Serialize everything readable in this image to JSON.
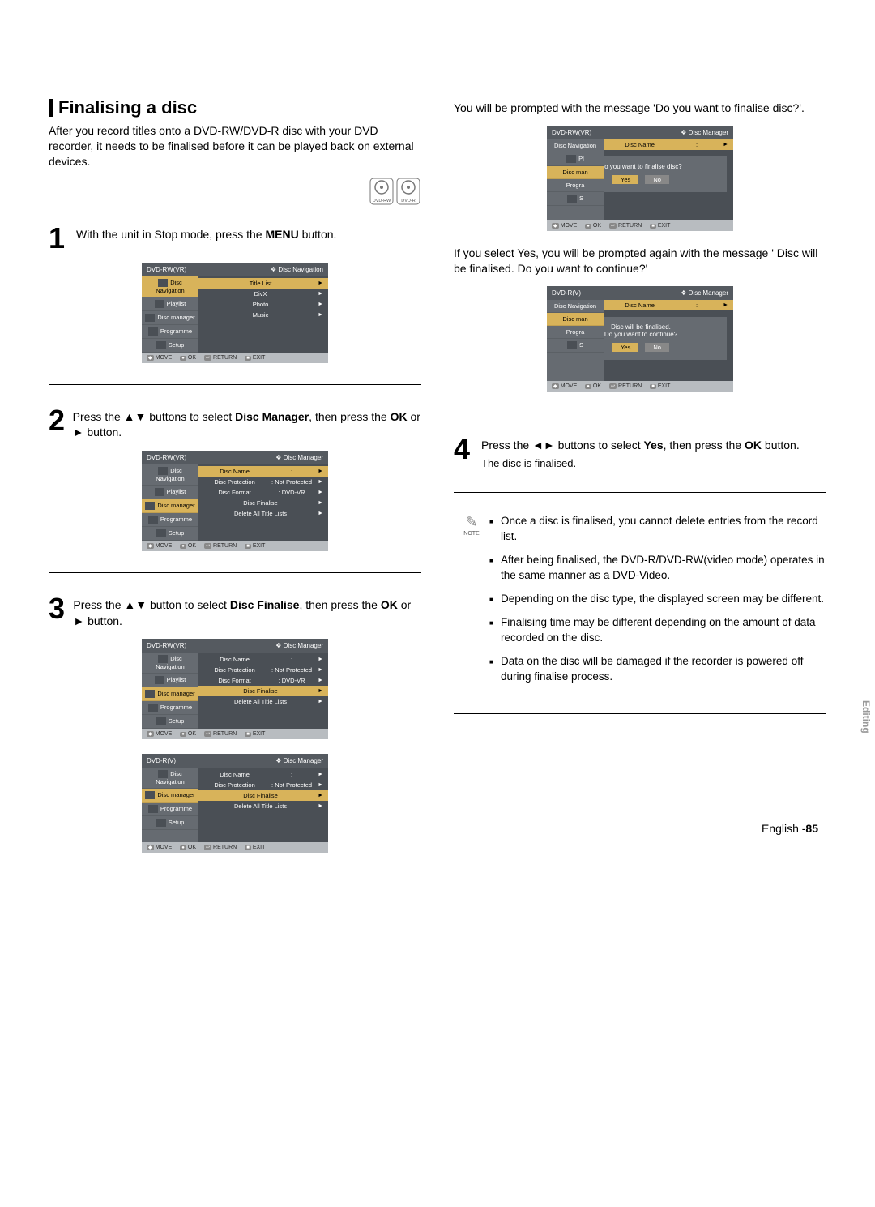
{
  "heading": "Finalising a disc",
  "intro": "After you record titles onto a DVD-RW/DVD-R disc with your DVD recorder, it needs to be finalised before it can be played back on external devices.",
  "disc_icons": [
    "DVD-RW",
    "DVD-R"
  ],
  "steps": {
    "s1": {
      "num": "1",
      "text_a": "With the unit in Stop mode, press the ",
      "bold": "MENU",
      "text_b": " button."
    },
    "s2": {
      "num": "2",
      "text_a": "Press the ▲▼ buttons to select ",
      "bold1": "Disc Manager",
      "text_b": ", then press the ",
      "bold2": "OK",
      "text_c": " or ► button."
    },
    "s3": {
      "num": "3",
      "text_a": "Press the ▲▼ button to select ",
      "bold1": "Disc Finalise",
      "text_b": ", then press the ",
      "bold2": "OK",
      "text_c": " or ► button."
    },
    "s4": {
      "num": "4",
      "text_a": "Press the ◄► buttons to select ",
      "bold1": "Yes",
      "text_b": ", then press the ",
      "bold2": "OK",
      "text_c": " button.",
      "sub": "The disc is finalised."
    }
  },
  "prompt_msg_a": "You will be prompted with the message 'Do you want to finalise disc?'.",
  "prompt_msg_b": "If you select Yes, you will be prompted again with the message ' Disc will be finalised. Do you want to continue?'",
  "osd_footer": {
    "move": "MOVE",
    "ok": "OK",
    "return": "RETURN",
    "exit": "EXIT"
  },
  "osd1": {
    "title_left": "DVD-RW(VR)",
    "title_right": "Disc Navigation",
    "side": [
      "Disc Navigation",
      "Playlist",
      "Disc manager",
      "Programme",
      "Setup"
    ],
    "main": [
      "Title List",
      "DivX",
      "Photo",
      "Music"
    ]
  },
  "osd2": {
    "title_left": "DVD-RW(VR)",
    "title_right": "Disc Manager",
    "side": [
      "Disc Navigation",
      "Playlist",
      "Disc manager",
      "Programme",
      "Setup"
    ],
    "main": [
      {
        "label": "Disc Name",
        "val": ":"
      },
      {
        "label": "Disc Protection",
        "val": ": Not Protected"
      },
      {
        "label": "Disc Format",
        "val": ": DVD-VR"
      },
      {
        "label": "Disc Finalise",
        "val": ""
      },
      {
        "label": "Delete All Title Lists",
        "val": ""
      }
    ]
  },
  "osd3": {
    "title_left": "DVD-RW(VR)",
    "title_right": "Disc Manager",
    "side": [
      "Disc Navigation",
      "Playlist",
      "Disc manager",
      "Programme",
      "Setup"
    ],
    "main": [
      {
        "label": "Disc Name",
        "val": ":"
      },
      {
        "label": "Disc Protection",
        "val": ": Not Protected"
      },
      {
        "label": "Disc Format",
        "val": ": DVD-VR"
      },
      {
        "label": "Disc Finalise",
        "val": "",
        "hl": true
      },
      {
        "label": "Delete All Title Lists",
        "val": ""
      }
    ]
  },
  "osd4": {
    "title_left": "DVD-R(V)",
    "title_right": "Disc Manager",
    "side": [
      "Disc Navigation",
      "Disc manager",
      "Programme",
      "Setup"
    ],
    "main": [
      {
        "label": "Disc Name",
        "val": ":"
      },
      {
        "label": "Disc Protection",
        "val": ": Not Protected"
      },
      {
        "label": "Disc Finalise",
        "val": "",
        "hl": true
      },
      {
        "label": "Delete All Title Lists",
        "val": ""
      }
    ]
  },
  "osd5": {
    "title_left": "DVD-RW(VR)",
    "title_right": "Disc Manager",
    "side": [
      "Disc Navigation",
      "Pl",
      "Disc man",
      "Progra",
      "S"
    ],
    "row": {
      "label": "Disc Name",
      "val": ":"
    },
    "prompt": "Do you want to finalise disc?",
    "yes": "Yes",
    "no": "No"
  },
  "osd6": {
    "title_left": "DVD-R(V)",
    "title_right": "Disc Manager",
    "side": [
      "Disc Navigation",
      "Disc man",
      "Progra",
      "S"
    ],
    "row": {
      "label": "Disc Name",
      "val": ":"
    },
    "prompt1": "Disc will be finalised.",
    "prompt2": "Do you want to continue?",
    "yes": "Yes",
    "no": "No"
  },
  "notes": [
    "Once a disc is finalised, you cannot delete entries from the record list.",
    "After being finalised, the DVD-R/DVD-RW(video mode) operates in the same manner as a DVD-Video.",
    "Depending on the disc type, the displayed screen may be different.",
    "Finalising time may be different depending on the amount of data recorded on the disc.",
    "Data on the disc will be damaged if the recorder is powered off during finalise process."
  ],
  "note_label": "NOTE",
  "side_tab": "Editing",
  "footer": {
    "lang": "English -",
    "page": "85"
  }
}
